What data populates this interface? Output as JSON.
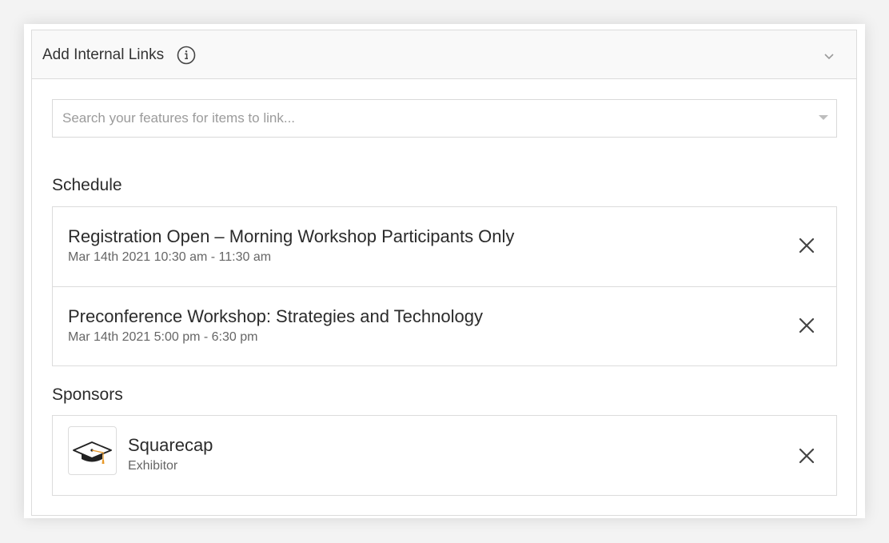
{
  "header": {
    "title": "Add Internal Links",
    "info_icon": "info-icon",
    "collapse_icon": "chevron-down-icon"
  },
  "search": {
    "placeholder": "Search your features for items to link...",
    "value": ""
  },
  "sections": {
    "schedule": {
      "title": "Schedule",
      "items": [
        {
          "title": "Registration Open – Morning Workshop Participants Only",
          "subtitle": "Mar 14th 2021 10:30 am - 11:30 am"
        },
        {
          "title": "Preconference Workshop: Strategies and Technology",
          "subtitle": "Mar 14th 2021 5:00 pm - 6:30 pm"
        }
      ]
    },
    "sponsors": {
      "title": "Sponsors",
      "items": [
        {
          "name": "Squarecap",
          "type": "Exhibitor",
          "logo_icon": "graduation-cap-icon"
        }
      ]
    }
  },
  "colors": {
    "border": "#dcdcdc",
    "header_bg": "#f9f9f9",
    "text": "#2b2b2b",
    "muted": "#666666",
    "placeholder": "#9b9b9b"
  }
}
